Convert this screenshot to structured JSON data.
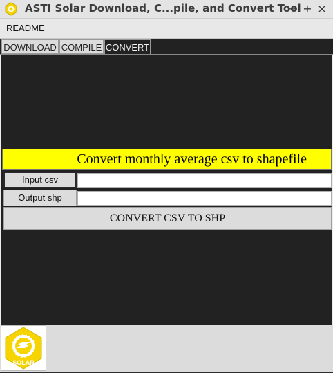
{
  "window": {
    "title": "ASTI Solar Download, C...pile, and Convert Tool",
    "minimize_glyph": "−",
    "maximize_glyph": "+",
    "close_glyph": "×"
  },
  "menu": {
    "items": [
      {
        "label": "README"
      }
    ]
  },
  "tabs": [
    {
      "label": "DOWNLOAD",
      "active": false
    },
    {
      "label": "COMPILE",
      "active": false
    },
    {
      "label": "CONVERT",
      "active": true
    }
  ],
  "convert": {
    "heading": "Convert monthly average csv to shapefile",
    "input_csv_label": "Input csv",
    "input_csv_value": "",
    "output_shp_label": "Output shp",
    "output_shp_value": "",
    "convert_button": "CONVERT CSV TO SHP"
  },
  "logo": {
    "text": "SOLAR",
    "icon": "solar-logo-icon"
  },
  "colors": {
    "heading_bg": "#ffff00",
    "panel_bg": "#222222",
    "logo_yellow": "#f5d400"
  }
}
